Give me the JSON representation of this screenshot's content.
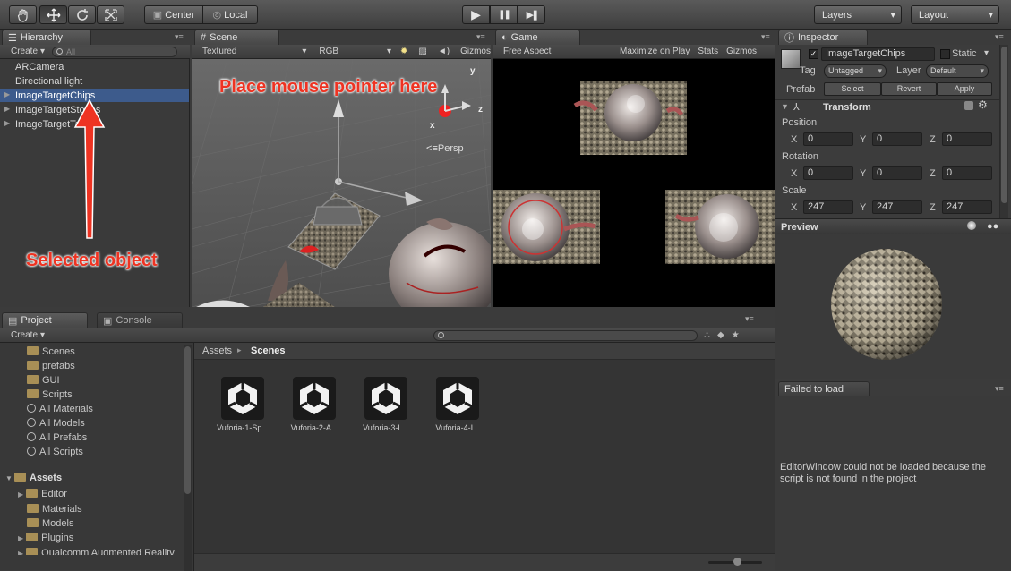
{
  "toolbar": {
    "tools": [
      "hand-tool",
      "move-tool",
      "rotate-tool",
      "scale-tool"
    ],
    "pivot_label": "Center",
    "space_label": "Local",
    "play": "▶",
    "pause": "❚❚",
    "step": "▶❚",
    "layers_label": "Layers",
    "layout_label": "Layout"
  },
  "hierarchy": {
    "tab": "Hierarchy",
    "create": "Create",
    "search_placeholder": "All",
    "items": [
      "ARCamera",
      "Directional light",
      "ImageTargetChips",
      "ImageTargetStones",
      "ImageTargetTarmac"
    ]
  },
  "scene": {
    "tab": "Scene",
    "render_mode": "Textured",
    "color_mode": "RGB",
    "gizmos": "Gizmos",
    "persp": "Persp",
    "axis_y": "y",
    "axis_x": "x",
    "axis_z": "z"
  },
  "game": {
    "tab": "Game",
    "aspect": "Free Aspect",
    "maximize": "Maximize on Play",
    "stats": "Stats",
    "gizmos": "Gizmos"
  },
  "inspector": {
    "tab": "Inspector",
    "object_name": "ImageTargetChips",
    "static_label": "Static",
    "tag_label": "Tag",
    "tag_value": "Untagged",
    "layer_label": "Layer",
    "layer_value": "Default",
    "prefab_label": "Prefab",
    "select": "Select",
    "revert": "Revert",
    "apply": "Apply",
    "transform": "Transform",
    "position_label": "Position",
    "rotation_label": "Rotation",
    "scale_label": "Scale",
    "x": "X",
    "y": "Y",
    "z": "Z",
    "position": [
      "0",
      "0",
      "0"
    ],
    "rotation": [
      "0",
      "0",
      "0"
    ],
    "scale": [
      "247",
      "247",
      "247"
    ]
  },
  "preview": {
    "title": "Preview"
  },
  "failed": {
    "tab": "Failed to load",
    "message": "EditorWindow could not be loaded because the script is not found in the project"
  },
  "project": {
    "tab": "Project",
    "console_tab": "Console",
    "create": "Create",
    "tree": [
      "Scenes",
      "prefabs",
      "GUI",
      "Scripts"
    ],
    "searches": [
      "All Materials",
      "All Models",
      "All Prefabs",
      "All Scripts"
    ],
    "assets_root": "Assets",
    "asset_folders": [
      "Editor",
      "Materials",
      "Models",
      "Plugins",
      "Qualcomm Augmented Reality"
    ],
    "breadcrumb_root": "Assets",
    "breadcrumb_current": "Scenes",
    "assets": [
      "Vuforia-1-Sp...",
      "Vuforia-2-A...",
      "Vuforia-3-L...",
      "Vuforia-4-I..."
    ]
  },
  "annotations": {
    "place_mouse": "Place mouse pointer here",
    "selected_object": "Selected object"
  },
  "colors": {
    "annotation": "#ee3322",
    "selection": "#3d5b8c",
    "background": "#3b3b3b"
  }
}
